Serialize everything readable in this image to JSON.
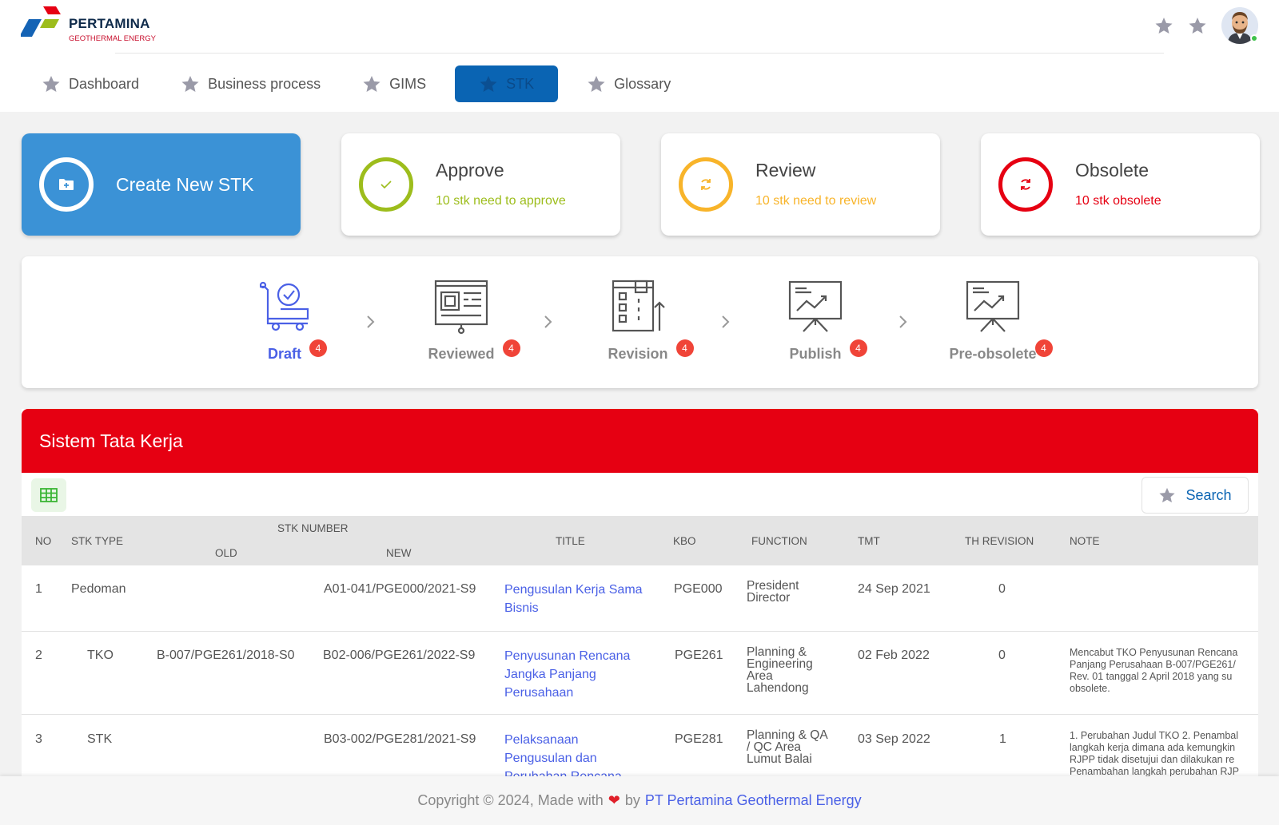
{
  "brand": {
    "name": "PERTAMINA",
    "subtitle": "GEOTHERMAL ENERGY"
  },
  "header": {
    "icons": [
      "star-icon",
      "star-icon",
      "avatar"
    ]
  },
  "nav": {
    "items": [
      {
        "label": "Dashboard",
        "icon": "star-icon"
      },
      {
        "label": "Business process",
        "icon": "star-icon"
      },
      {
        "label": "GIMS",
        "icon": "star-icon"
      },
      {
        "label": "STK",
        "icon": "star-icon",
        "active": true
      },
      {
        "label": "Glossary",
        "icon": "star-icon"
      }
    ]
  },
  "cards": {
    "create": {
      "label": "Create New STK",
      "icon": "folder-plus-icon"
    },
    "approve": {
      "title": "Approve",
      "subtitle": "10 stk need to approve",
      "color": "#9dbd1c"
    },
    "review": {
      "title": "Review",
      "subtitle": "10 stk need to review",
      "color": "#f8b42a"
    },
    "obsolete": {
      "title": "Obsolete",
      "subtitle": "10 stk obsolete",
      "color": "#e60012"
    }
  },
  "steps": [
    {
      "label": "Draft",
      "count": "4",
      "icon": "cart-check-icon"
    },
    {
      "label": "Reviewed",
      "count": "4",
      "icon": "document-board-icon"
    },
    {
      "label": "Revision",
      "count": "4",
      "icon": "building-revision-icon"
    },
    {
      "label": "Publish",
      "count": "4",
      "icon": "presentation-chart-icon"
    },
    {
      "label": "Pre-obsolete",
      "count": "4",
      "icon": "presentation-chart-icon"
    }
  ],
  "table": {
    "title": "Sistem Tata Kerja",
    "search_label": "Search",
    "columns": {
      "no": "NO",
      "stk_type": "STK TYPE",
      "stk_number": "STK NUMBER",
      "old": "OLD",
      "new": "NEW",
      "title": "TITLE",
      "kbo": "KBO",
      "function": "FUNCTION",
      "tmt": "TMT",
      "th_revision": "TH REVISION",
      "note": "NOTE"
    },
    "rows": [
      {
        "no": "1",
        "type": "Pedoman",
        "old": "",
        "new": "A01-041/PGE000/2021-S9",
        "title": [
          "Pengusulan Kerja Sama",
          "Bisnis"
        ],
        "kbo": "PGE000",
        "function": [
          "President",
          "Director"
        ],
        "tmt": "24 Sep 2021",
        "rev": "0",
        "note": []
      },
      {
        "no": "2",
        "type": "TKO",
        "old": "B-007/PGE261/2018-S0",
        "new": "B02-006/PGE261/2022-S9",
        "title": [
          "Penyusunan Rencana",
          "Jangka Panjang",
          "Perusahaan"
        ],
        "kbo": "PGE261",
        "function": [
          "Planning &",
          "Engineering",
          "Area",
          "Lahendong"
        ],
        "tmt": "02 Feb 2022",
        "rev": "0",
        "note": [
          "Mencabut TKO Penyusunan Rencana",
          "Panjang Perusahaan B-007/PGE261/",
          "Rev. 01 tanggal 2 April 2018 yang su",
          "obsolete."
        ]
      },
      {
        "no": "3",
        "type": "STK",
        "old": "",
        "new": "B03-002/PGE281/2021-S9",
        "title": [
          "Pelaksanaan",
          "Pengusulan dan",
          "Perubahan Rencana"
        ],
        "kbo": "PGE281",
        "function": [
          "Planning & QA",
          "/ QC Area",
          "Lumut Balai"
        ],
        "tmt": "03 Sep 2022",
        "rev": "1",
        "note": [
          "1. Perubahan Judul TKO 2. Penambal",
          "langkah kerja dimana ada kemungkin",
          "RJPP tidak disetujui dan dilakukan re",
          "Penambahan langkah perubahan RJP"
        ]
      }
    ]
  },
  "footer": {
    "prefix": "Copyright © 2024, Made with",
    "heart": "❤",
    "by": "by",
    "company": "PT Pertamina Geothermal Energy"
  }
}
